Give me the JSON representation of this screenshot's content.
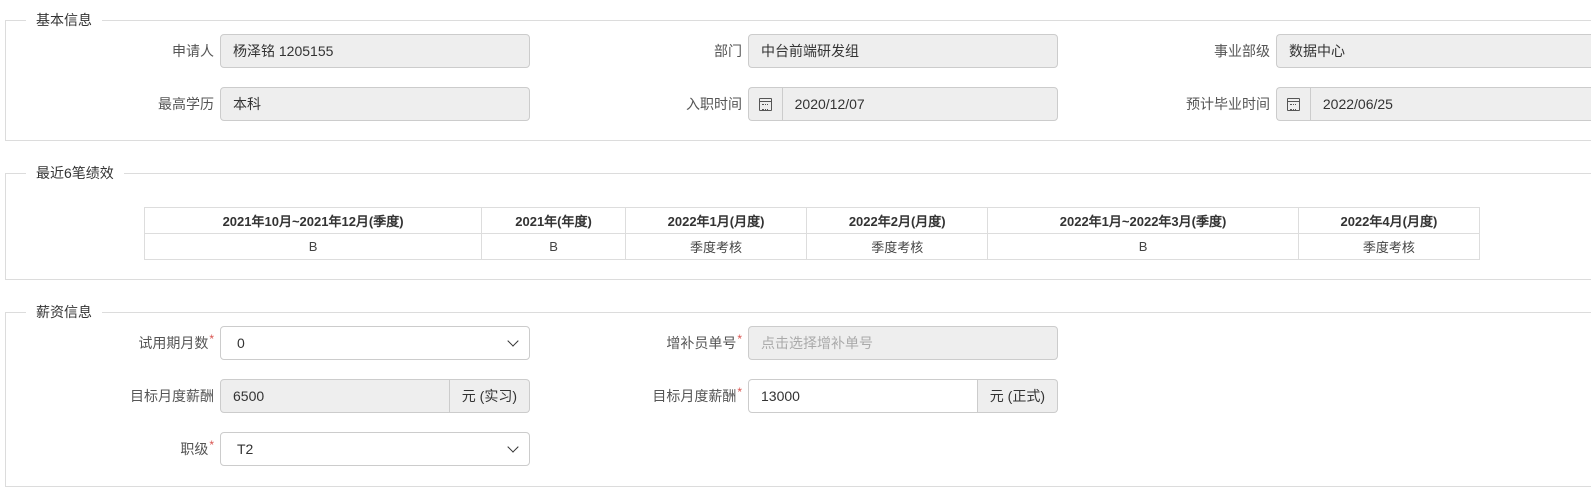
{
  "basic_info": {
    "legend": "基本信息",
    "applicant": {
      "label": "申请人",
      "value": "杨泽铭 1205155"
    },
    "department": {
      "label": "部门",
      "value": "中台前端研发组"
    },
    "business_unit": {
      "label": "事业部级",
      "value": "数据中心"
    },
    "education": {
      "label": "最高学历",
      "value": "本科"
    },
    "hire_date": {
      "label": "入职时间",
      "value": "2020/12/07",
      "icon": "calendar-icon"
    },
    "graduation_date": {
      "label": "预计毕业时间",
      "value": "2022/06/25",
      "icon": "calendar-icon"
    }
  },
  "performance": {
    "legend": "最近6笔绩效",
    "headers": [
      "2021年10月~2021年12月(季度)",
      "2021年(年度)",
      "2022年1月(月度)",
      "2022年2月(月度)",
      "2022年1月~2022年3月(季度)",
      "2022年4月(月度)"
    ],
    "values": [
      "B",
      "B",
      "季度考核",
      "季度考核",
      "B",
      "季度考核"
    ]
  },
  "salary": {
    "legend": "薪资信息",
    "probation_months": {
      "label": "试用期月数",
      "required_mark": "*",
      "value": "0"
    },
    "supplement_no": {
      "label": "增补员单号",
      "required_mark": "*",
      "placeholder": "点击选择增补单号"
    },
    "intern_salary": {
      "label": "目标月度薪酬",
      "value": "6500",
      "unit": "元 (实习)"
    },
    "formal_salary": {
      "label": "目标月度薪酬",
      "required_mark": "*",
      "value": "13000",
      "unit": "元 (正式)"
    },
    "rank": {
      "label": "职级",
      "required_mark": "*",
      "value": "T2"
    }
  }
}
